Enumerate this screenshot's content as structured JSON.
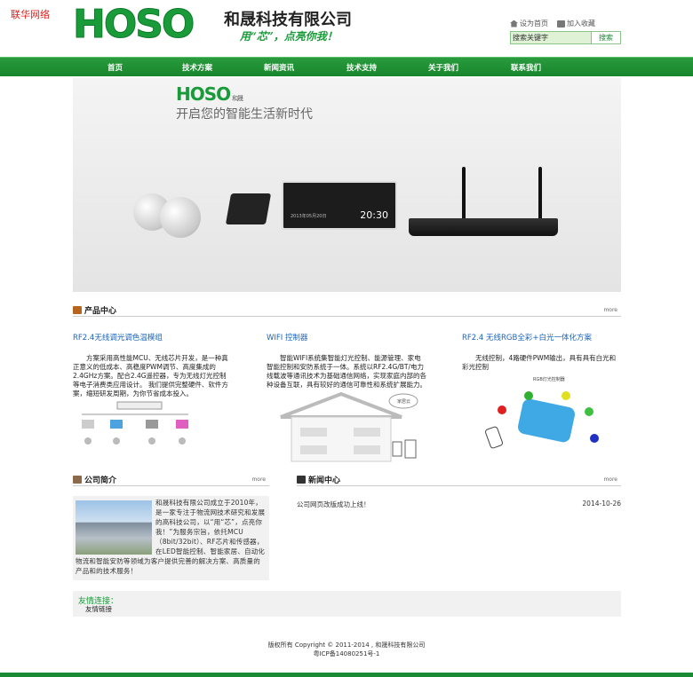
{
  "corner_label": "联华网络",
  "header": {
    "logo_text": "HOSO",
    "company_name": "和晟科技有限公司",
    "slogan": "用“芯”，点亮你我！",
    "set_home": "设为首页",
    "add_fav": "加入收藏",
    "search_placeholder": "搜索关键字",
    "search_value": "搜索关键字",
    "search_button": "搜索"
  },
  "nav": [
    "首页",
    "技术方案",
    "新闻资讯",
    "技术支持",
    "关于我们",
    "联系我们"
  ],
  "banner": {
    "logo": "HOSO",
    "logo_small": "和晟",
    "tagline": "开启您的智能生活新时代",
    "clock": "20:30",
    "date": "2013年05月20日"
  },
  "products": {
    "title": "产品中心",
    "more": "more",
    "items": [
      {
        "title": "RF2.4无线调光调色温模组",
        "desc": "方案采用高性能MCU、无线芯片开发，是一种真正意义的低成本、高稳度PWM调节、高度集成的2.4GHz方案。配合2.4G遥控器，专为无线灯光控制等电子消费类应用设计。 我们提供完整硬件、软件方案，缩短研发周期，为你节省成本投入。"
      },
      {
        "title": "WIFI 控制器",
        "desc": "智能WIFI系统集智能灯光控制、能源管理、家电智能控制和安防系统于一体。系统以RF2.4G/BT/电力线载波等通讯技术为基础通信网络，实现家庭内部的各种设备互联，具有较好的通信可靠性和系统扩展能力。",
        "cloud_label": "家居云"
      },
      {
        "title": "RF2.4 无线RGB全彩+白光一体化方案",
        "desc": "无线控制，4路硬件PWM输出，具有具有白光和彩光控制",
        "diagram_label": "RGB灯光控制器"
      }
    ]
  },
  "about": {
    "title": "公司简介",
    "more": "more",
    "text": "和晟科技有限公司成立于2010年，是一家专注于物流网技术研究和发展的高科技公司，以“用“芯”，点亮你我！”为服务宗旨，依托MCU（8bit/32bit）、RF芯片和传感器，在LED智能控制、智能家居、自动化物流和智能安防等领域为客户提供完善的解决方案、高质量的产品和的技术服务！"
  },
  "news": {
    "title": "新闻中心",
    "more": "more",
    "items": [
      {
        "title": "公司网页改版成功上线！",
        "date": "2014-10-26"
      }
    ]
  },
  "friend": {
    "title": "友情连接：",
    "link": "友情链接"
  },
  "footer": {
    "copyright": "版权所有 Copyright © 2011-2014 , 和晟科技有限公司",
    "icp": "粤ICP备14080251号-1"
  },
  "colors": {
    "brand_green": "#1a9b3a",
    "link_blue": "#1a64b8",
    "corner_red": "#e0201c"
  }
}
